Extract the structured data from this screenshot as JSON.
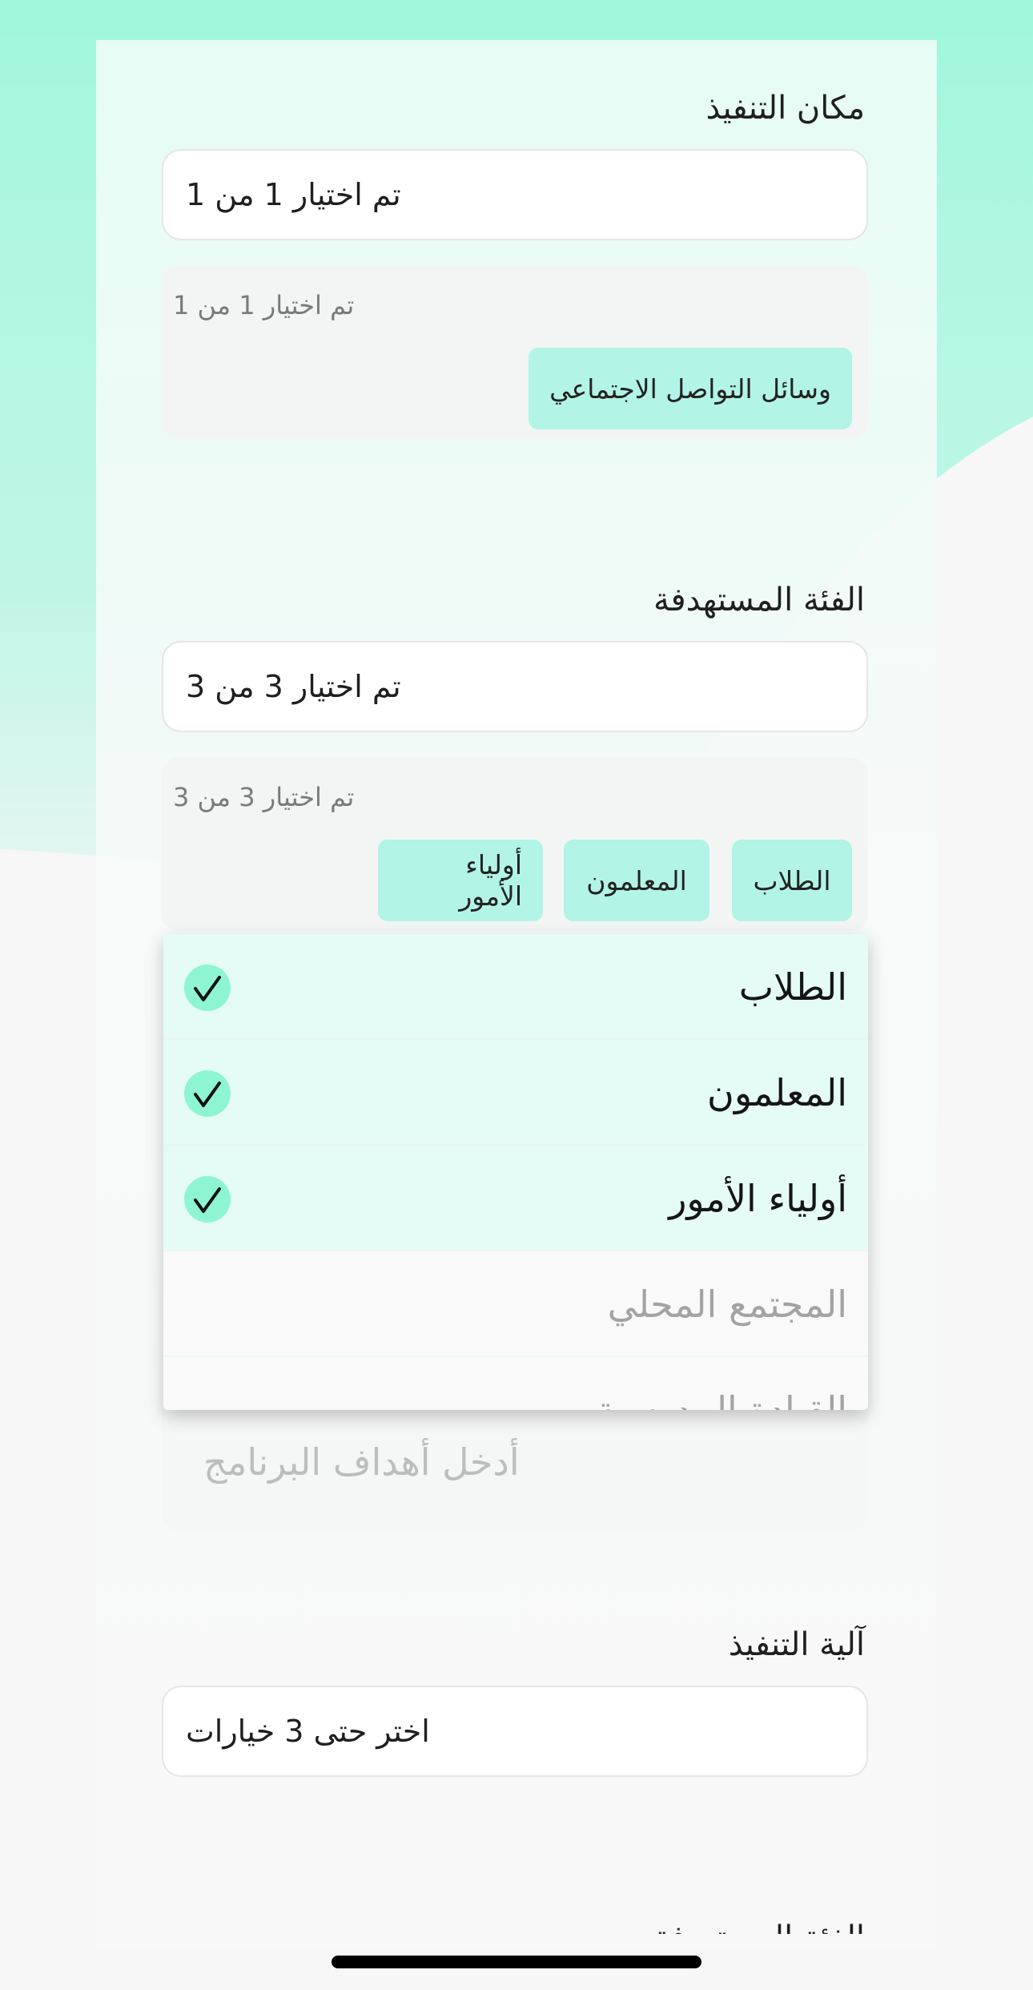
{
  "colors": {
    "accent": "#8ef5d2",
    "chip": "#b2f4e6",
    "selected_row": "#e4fcf5"
  },
  "execution_place": {
    "label": "مكان التنفيذ",
    "field_value": "تم اختيار 1 من 1",
    "selected_count": "تم اختيار 1 من 1",
    "chips": [
      "وسائل التواصل الاجتماعي"
    ]
  },
  "target_group": {
    "label": "الفئة المستهدفة",
    "field_value": "تم اختيار 3 من 3",
    "selected_count": "تم اختيار 3 من 3",
    "chips": [
      "الطلاب",
      "المعلمون",
      "أولياء الأمور"
    ],
    "dropdown_options": [
      {
        "label": "الطلاب",
        "selected": true
      },
      {
        "label": "المعلمون",
        "selected": true
      },
      {
        "label": "أولياء الأمور",
        "selected": true
      },
      {
        "label": "المجتمع المحلي",
        "selected": false
      },
      {
        "label": "القيادة المدرسية",
        "selected": false
      }
    ]
  },
  "objectives": {
    "placeholder": "أدخل أهداف البرنامج"
  },
  "execution_mechanism": {
    "label": "آلية التنفيذ",
    "field_value": "اختر حتى 3 خيارات"
  },
  "next_section_label": "الفئة المستهدفة"
}
